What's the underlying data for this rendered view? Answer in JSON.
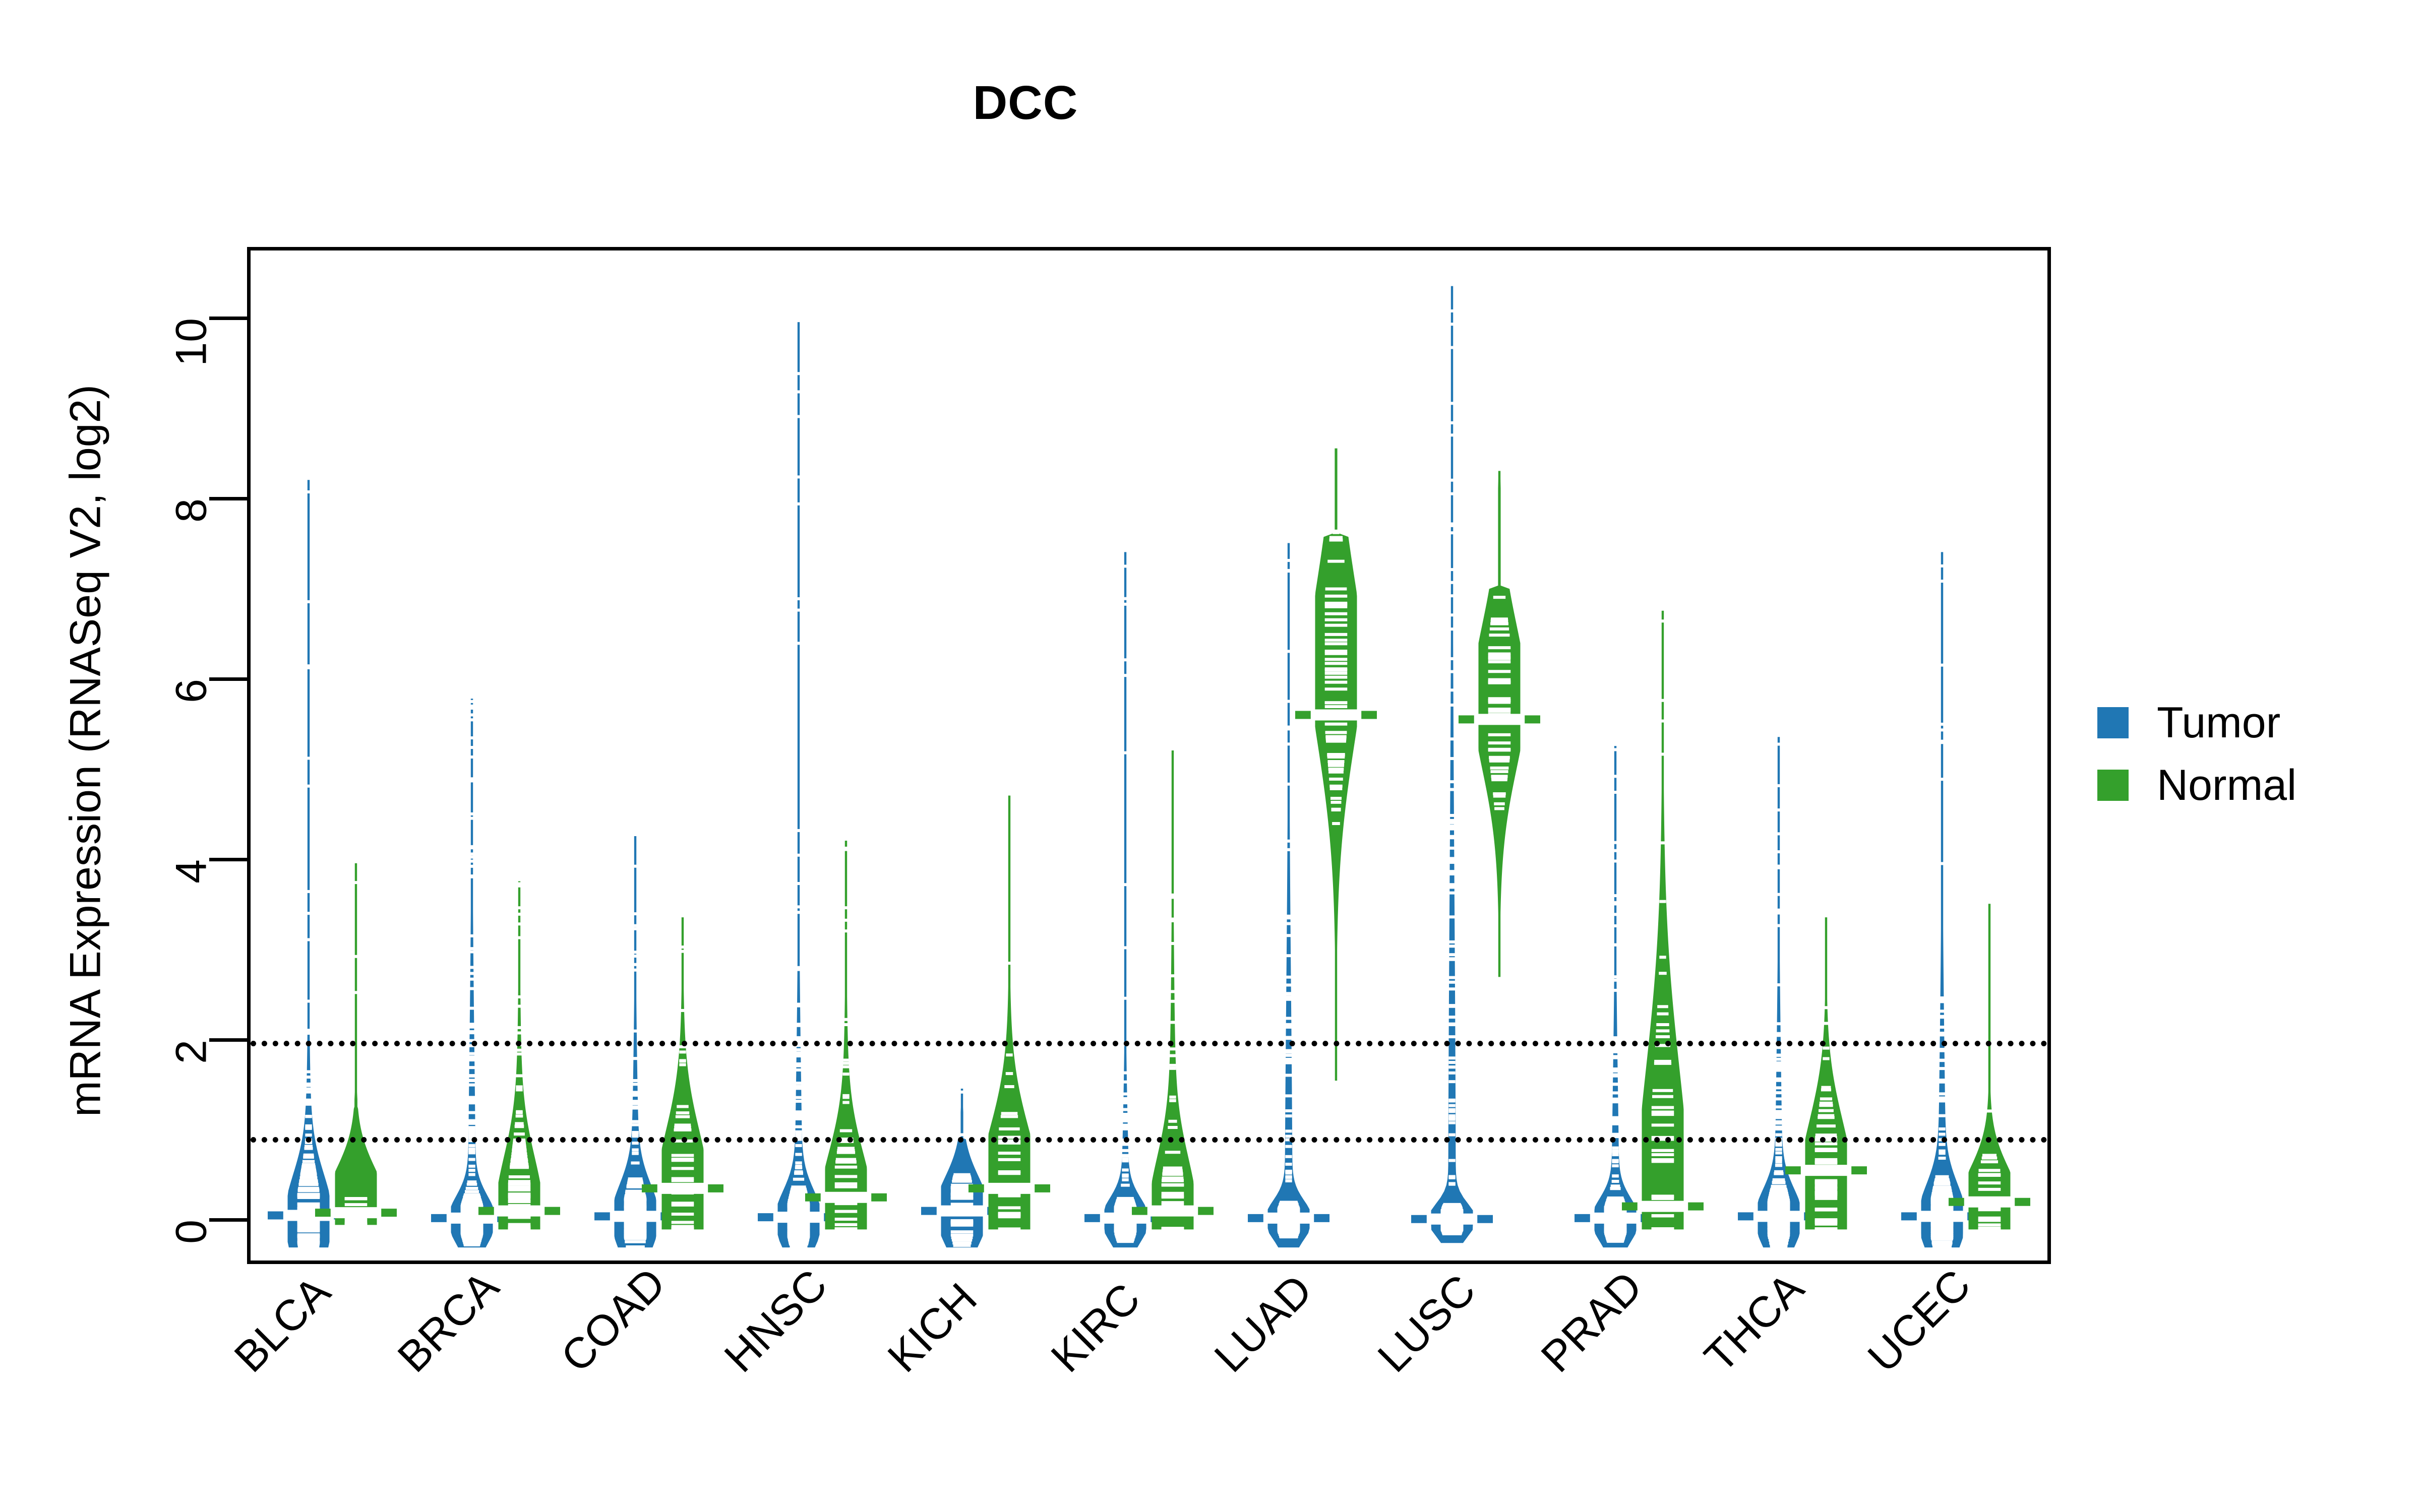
{
  "chart_data": {
    "type": "violin",
    "title": "DCC",
    "xlabel": "",
    "ylabel": "mRNA Expression (RNASeq V2, log2)",
    "ylim": [
      -0.45,
      10.75
    ],
    "yticks": [
      0,
      2,
      4,
      6,
      8,
      10
    ],
    "ytick_labels": [
      "0",
      "2",
      "4",
      "6",
      "8",
      "10"
    ],
    "grid": false,
    "reference_lines": [
      {
        "value": 2.0,
        "style": "dotted"
      },
      {
        "value": 0.93,
        "style": "dotted"
      }
    ],
    "legend": {
      "position": "right",
      "entries": [
        {
          "label": "Tumor",
          "color": "#2077B4"
        },
        {
          "label": "Normal",
          "color": "#34A02C"
        }
      ]
    },
    "categories": [
      "BLCA",
      "BRCA",
      "COAD",
      "HNSC",
      "KICH",
      "KIRC",
      "LUAD",
      "LUSC",
      "PRAD",
      "THCA",
      "UCEC"
    ],
    "series": [
      {
        "name": "Tumor",
        "color": "#2077B4",
        "groups": [
          {
            "category": "BLCA",
            "median": 0.05,
            "min": -0.3,
            "max": 8.2,
            "q1": 0.0,
            "q3": 0.75,
            "bulk_top": 2.9,
            "density_peak": 0.02,
            "n_points": 120
          },
          {
            "category": "BRCA",
            "median": 0.02,
            "min": -0.3,
            "max": 5.8,
            "q1": 0.0,
            "q3": 0.35,
            "bulk_top": 4.8,
            "density_peak": 0.0,
            "n_points": 190
          },
          {
            "category": "COAD",
            "median": 0.04,
            "min": -0.3,
            "max": 4.25,
            "q1": 0.0,
            "q3": 0.55,
            "bulk_top": 3.4,
            "density_peak": 0.02,
            "n_points": 110
          },
          {
            "category": "HNSC",
            "median": 0.03,
            "min": -0.3,
            "max": 9.95,
            "q1": 0.0,
            "q3": 0.45,
            "bulk_top": 4.0,
            "density_peak": 0.0,
            "n_points": 160
          },
          {
            "category": "KICH",
            "median": 0.1,
            "min": -0.3,
            "max": 1.45,
            "q1": 0.0,
            "q3": 0.55,
            "bulk_top": 0.9,
            "density_peak": 0.1,
            "n_points": 40
          },
          {
            "category": "KIRC",
            "median": 0.02,
            "min": -0.3,
            "max": 7.4,
            "q1": 0.0,
            "q3": 0.3,
            "bulk_top": 2.6,
            "density_peak": 0.0,
            "n_points": 140
          },
          {
            "category": "LUAD",
            "median": 0.02,
            "min": -0.3,
            "max": 7.5,
            "q1": 0.0,
            "q3": 0.25,
            "bulk_top": 6.2,
            "density_peak": 0.0,
            "n_points": 160
          },
          {
            "category": "LUSC",
            "median": 0.01,
            "min": -0.25,
            "max": 10.35,
            "q1": 0.0,
            "q3": 0.2,
            "bulk_top": 9.0,
            "density_peak": 0.0,
            "n_points": 180
          },
          {
            "category": "PRAD",
            "median": 0.02,
            "min": -0.3,
            "max": 5.25,
            "q1": 0.0,
            "q3": 0.3,
            "bulk_top": 3.9,
            "density_peak": 0.0,
            "n_points": 160
          },
          {
            "category": "THCA",
            "median": 0.04,
            "min": -0.3,
            "max": 5.35,
            "q1": 0.0,
            "q3": 0.45,
            "bulk_top": 4.0,
            "density_peak": 0.02,
            "n_points": 170
          },
          {
            "category": "UCEC",
            "median": 0.04,
            "min": -0.3,
            "max": 7.4,
            "q1": 0.0,
            "q3": 0.55,
            "bulk_top": 4.5,
            "density_peak": 0.02,
            "n_points": 130
          }
        ]
      },
      {
        "name": "Normal",
        "color": "#34A02C",
        "groups": [
          {
            "category": "BLCA",
            "median": 0.08,
            "min": -0.05,
            "max": 3.95,
            "q1": 0.0,
            "q3": 0.7,
            "bulk_top": 1.25,
            "density_peak": 0.1,
            "n_points": 18
          },
          {
            "category": "BRCA",
            "median": 0.1,
            "min": -0.1,
            "max": 3.75,
            "q1": 0.0,
            "q3": 1.05,
            "bulk_top": 3.55,
            "density_peak": 0.05,
            "n_points": 95
          },
          {
            "category": "COAD",
            "median": 0.35,
            "min": -0.1,
            "max": 3.35,
            "q1": 0.05,
            "q3": 1.25,
            "bulk_top": 3.2,
            "density_peak": 0.25,
            "n_points": 40
          },
          {
            "category": "HNSC",
            "median": 0.25,
            "min": -0.1,
            "max": 4.2,
            "q1": 0.0,
            "q3": 1.05,
            "bulk_top": 3.3,
            "density_peak": 0.1,
            "n_points": 45
          },
          {
            "category": "KICH",
            "median": 0.35,
            "min": -0.1,
            "max": 4.7,
            "q1": 0.05,
            "q3": 1.35,
            "bulk_top": 3.0,
            "density_peak": 0.2,
            "n_points": 25
          },
          {
            "category": "KIRC",
            "median": 0.1,
            "min": -0.1,
            "max": 5.2,
            "q1": 0.0,
            "q3": 1.05,
            "bulk_top": 4.6,
            "density_peak": 0.05,
            "n_points": 70
          },
          {
            "category": "LUAD",
            "median": 5.6,
            "min": 1.55,
            "max": 8.55,
            "q1": 4.35,
            "q3": 6.45,
            "bulk_top": 7.6,
            "density_peak": 6.2,
            "n_points": 55
          },
          {
            "category": "LUSC",
            "median": 5.55,
            "min": 2.7,
            "max": 8.3,
            "q1": 4.75,
            "q3": 6.3,
            "bulk_top": 7.0,
            "density_peak": 5.8,
            "n_points": 45
          },
          {
            "category": "PRAD",
            "median": 0.15,
            "min": -0.1,
            "max": 6.75,
            "q1": 0.0,
            "q3": 2.85,
            "bulk_top": 5.6,
            "density_peak": 0.05,
            "n_points": 50
          },
          {
            "category": "THCA",
            "median": 0.55,
            "min": -0.1,
            "max": 3.35,
            "q1": 0.1,
            "q3": 1.35,
            "bulk_top": 2.6,
            "density_peak": 0.35,
            "n_points": 58
          },
          {
            "category": "UCEC",
            "median": 0.2,
            "min": -0.1,
            "max": 3.5,
            "q1": 0.0,
            "q3": 0.7,
            "bulk_top": 1.4,
            "density_peak": 0.1,
            "n_points": 24
          }
        ]
      }
    ]
  },
  "legend": {
    "tumor_label": "Tumor",
    "normal_label": "Normal"
  },
  "axes": {
    "title": "DCC",
    "ylabel": "mRNA Expression (RNASeq V2, log2)"
  }
}
